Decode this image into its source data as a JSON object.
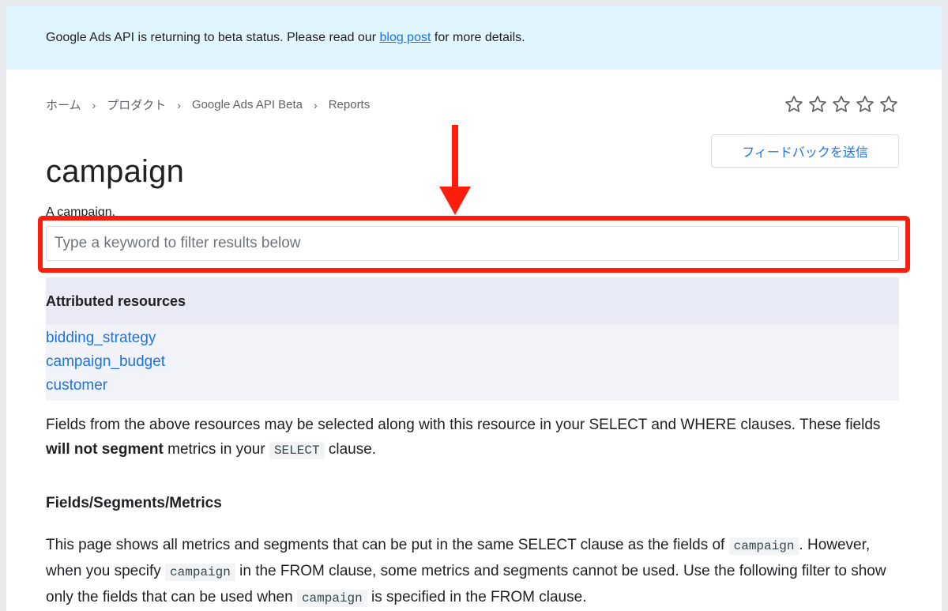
{
  "banner": {
    "text_before": "Google Ads API is returning to beta status. Please read our ",
    "link": "blog post",
    "text_after": " for more details."
  },
  "breadcrumb": {
    "items": [
      "ホーム",
      "プロダクト",
      "Google Ads API Beta",
      "Reports"
    ],
    "separator": "›"
  },
  "rating": {
    "star_count": 5,
    "icon": "star-outline-icon"
  },
  "title": "campaign",
  "feedback_button": "フィードバックを送信",
  "description": "A campaign.",
  "filter": {
    "placeholder": "Type a keyword to filter results below",
    "value": ""
  },
  "annotation": {
    "highlight_color": "#ff1e0e",
    "arrow_color": "#ff1e0e"
  },
  "attributed": {
    "heading": "Attributed resources",
    "links": [
      "bidding_strategy",
      "campaign_budget",
      "customer"
    ]
  },
  "fields_note": {
    "part1": "Fields from the above resources may be selected along with this resource in your SELECT and WHERE clauses. These fields ",
    "bold": "will not segment",
    "part2": " metrics in your ",
    "code": "SELECT",
    "part3": " clause."
  },
  "section": {
    "heading": "Fields/Segments/Metrics"
  },
  "section_para": {
    "part1": "This page shows all metrics and segments that can be put in the same SELECT clause as the fields of ",
    "code1": "campaign",
    "part2": ". However, when you specify ",
    "code2": "campaign",
    "part3": " in the FROM clause, some metrics and segments cannot be used. Use the following filter to show only the fields that can be used when ",
    "code3": "campaign",
    "part4": " is specified in the FROM clause."
  },
  "colors": {
    "link": "#1a73e8",
    "banner_bg": "#e1f5fe",
    "table_head_bg": "#e8eaf6",
    "table_body_bg": "#f1f3f9"
  }
}
